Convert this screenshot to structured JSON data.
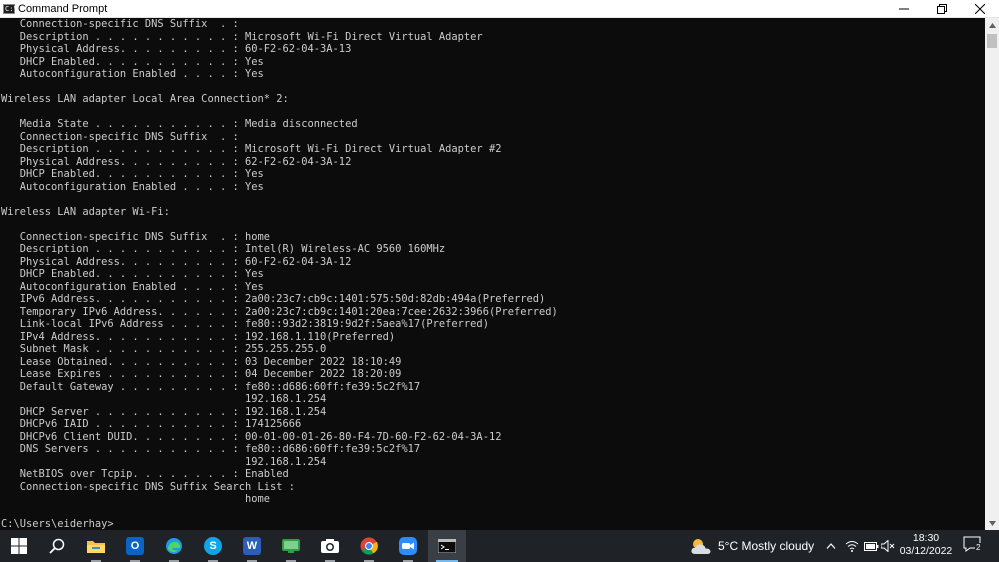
{
  "window": {
    "title": "Command Prompt",
    "icon_name": "cmd-icon"
  },
  "console": {
    "lines": [
      "   Connection-specific DNS Suffix  . :",
      "   Description . . . . . . . . . . . : Microsoft Wi-Fi Direct Virtual Adapter",
      "   Physical Address. . . . . . . . . : 60-F2-62-04-3A-13",
      "   DHCP Enabled. . . . . . . . . . . : Yes",
      "   Autoconfiguration Enabled . . . . : Yes",
      "",
      "Wireless LAN adapter Local Area Connection* 2:",
      "",
      "   Media State . . . . . . . . . . . : Media disconnected",
      "   Connection-specific DNS Suffix  . :",
      "   Description . . . . . . . . . . . : Microsoft Wi-Fi Direct Virtual Adapter #2",
      "   Physical Address. . . . . . . . . : 62-F2-62-04-3A-12",
      "   DHCP Enabled. . . . . . . . . . . : Yes",
      "   Autoconfiguration Enabled . . . . : Yes",
      "",
      "Wireless LAN adapter Wi-Fi:",
      "",
      "   Connection-specific DNS Suffix  . : home",
      "   Description . . . . . . . . . . . : Intel(R) Wireless-AC 9560 160MHz",
      "   Physical Address. . . . . . . . . : 60-F2-62-04-3A-12",
      "   DHCP Enabled. . . . . . . . . . . : Yes",
      "   Autoconfiguration Enabled . . . . : Yes",
      "   IPv6 Address. . . . . . . . . . . : 2a00:23c7:cb9c:1401:575:50d:82db:494a(Preferred)",
      "   Temporary IPv6 Address. . . . . . : 2a00:23c7:cb9c:1401:20ea:7cee:2632:3966(Preferred)",
      "   Link-local IPv6 Address . . . . . : fe80::93d2:3819:9d2f:5aea%17(Preferred)",
      "   IPv4 Address. . . . . . . . . . . : 192.168.1.110(Preferred)",
      "   Subnet Mask . . . . . . . . . . . : 255.255.255.0",
      "   Lease Obtained. . . . . . . . . . : 03 December 2022 18:10:49",
      "   Lease Expires . . . . . . . . . . : 04 December 2022 18:20:09",
      "   Default Gateway . . . . . . . . . : fe80::d686:60ff:fe39:5c2f%17",
      "                                       192.168.1.254",
      "   DHCP Server . . . . . . . . . . . : 192.168.1.254",
      "   DHCPv6 IAID . . . . . . . . . . . : 174125666",
      "   DHCPv6 Client DUID. . . . . . . . : 00-01-00-01-26-80-F4-7D-60-F2-62-04-3A-12",
      "   DNS Servers . . . . . . . . . . . : fe80::d686:60ff:fe39:5c2f%17",
      "                                       192.168.1.254",
      "   NetBIOS over Tcpip. . . . . . . . : Enabled",
      "   Connection-specific DNS Suffix Search List :",
      "                                       home",
      "",
      "C:\\Users\\eiderhay>"
    ]
  },
  "taskbar": {
    "apps": [
      {
        "name": "start-button",
        "icon": "windows-logo-icon"
      },
      {
        "name": "search-button",
        "icon": "search-icon"
      },
      {
        "name": "file-explorer",
        "icon": "folder-icon"
      },
      {
        "name": "outlook",
        "icon": "outlook-icon"
      },
      {
        "name": "edge",
        "icon": "edge-icon"
      },
      {
        "name": "skype",
        "icon": "skype-icon"
      },
      {
        "name": "word",
        "icon": "word-icon"
      },
      {
        "name": "phone-link",
        "icon": "phone-link-icon"
      },
      {
        "name": "camera",
        "icon": "camera-icon"
      },
      {
        "name": "chrome",
        "icon": "chrome-icon"
      },
      {
        "name": "zoom",
        "icon": "zoom-icon"
      },
      {
        "name": "command-prompt",
        "icon": "cmd-icon"
      }
    ],
    "weather": {
      "text": "5°C  Mostly cloudy",
      "icon": "partly-cloudy-icon"
    },
    "clock": {
      "time": "18:30",
      "date": "03/12/2022"
    },
    "notifications": {
      "count": "2"
    },
    "colors": {
      "taskbar_bg": "#1f2328",
      "active_indicator": "#76b9ed"
    }
  }
}
